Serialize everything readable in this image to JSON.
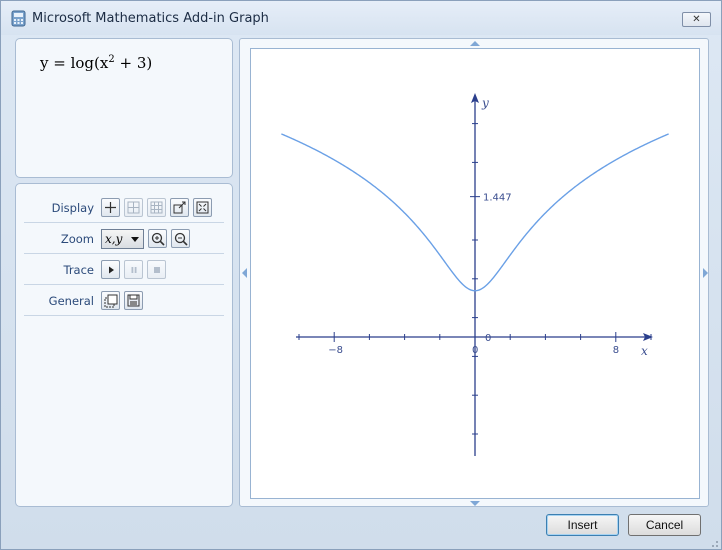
{
  "window": {
    "title": "Microsoft Mathematics Add-in Graph",
    "close_glyph": "✕"
  },
  "equation": {
    "lhs": "y",
    "eq": " = ",
    "func": "log(x",
    "exp": "2",
    "rest": " + 3)"
  },
  "controls": {
    "display_label": "Display",
    "zoom_label": "Zoom",
    "zoom_value": "x,y",
    "trace_label": "Trace",
    "general_label": "General"
  },
  "graph": {
    "x_axis_label": "x",
    "y_axis_label": "y",
    "x_tick_neg": "−8",
    "x_tick_zero": "0",
    "x_tick_pos": "8",
    "y_tick_value": "1.447",
    "curve_color": "#6aa0e6",
    "axis_color": "#2b3f8c"
  },
  "chart_data": {
    "type": "line",
    "function": "y = log(x^2 + 3)",
    "x": [
      -11,
      -10,
      -8,
      -6,
      -4,
      -2,
      -1,
      0,
      1,
      2,
      4,
      6,
      8,
      10,
      11
    ],
    "y": [
      2.09,
      2.01,
      1.83,
      1.59,
      1.28,
      0.85,
      0.6,
      0.477,
      0.6,
      0.85,
      1.28,
      1.59,
      1.83,
      2.01,
      2.09
    ],
    "xlim": [
      -11,
      11
    ],
    "ylim": [
      -1.6,
      2.4
    ],
    "y_tick_value": 1.447,
    "x_ticks": [
      -8,
      0,
      8
    ],
    "xlabel": "x",
    "ylabel": "y"
  },
  "buttons": {
    "insert": "Insert",
    "cancel": "Cancel"
  }
}
